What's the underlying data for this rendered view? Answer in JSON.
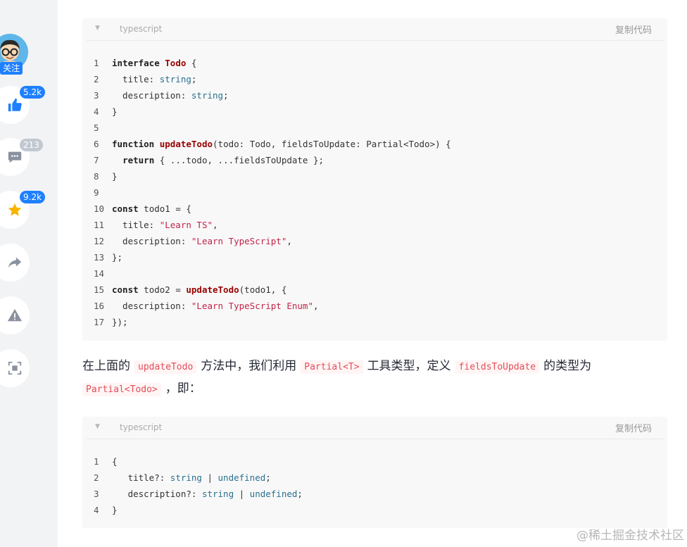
{
  "rail": {
    "follow_label": "关注",
    "like_count": "5.2k",
    "comment_count": "213",
    "collect_count": "9.2k"
  },
  "code_block_1": {
    "language": "typescript",
    "copy_label": "复制代码",
    "lines": [
      "1",
      "2",
      "3",
      "4",
      "5",
      "6",
      "7",
      "8",
      "9",
      "10",
      "11",
      "12",
      "13",
      "14",
      "15",
      "16",
      "17"
    ]
  },
  "code_block_2": {
    "language": "typescript",
    "copy_label": "复制代码",
    "lines": [
      "1",
      "2",
      "3",
      "4"
    ]
  },
  "paragraph": {
    "t1": "在上面的",
    "c1": "updateTodo",
    "t2": "方法中，我们利用",
    "c2": "Partial<T>",
    "t3": "工具类型，定义",
    "c3": "fieldsToUpdate",
    "t4": "的类型为",
    "c4": "Partial<Todo>",
    "t5": "，即："
  },
  "watermark": "@稀土掘金技术社区",
  "colors": {
    "accent": "#1e80ff",
    "inline_code": "#e34d59",
    "keyword_fn": "#990000",
    "type": "#2a7090",
    "string": "#c0254a"
  }
}
